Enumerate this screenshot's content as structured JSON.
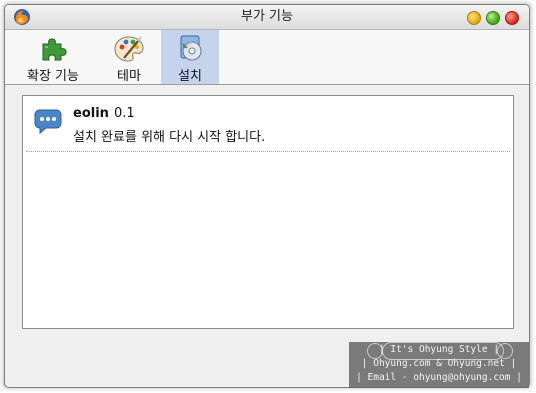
{
  "window": {
    "title": "부가 기능"
  },
  "titlebar_icons": {
    "app": "firefox-icon",
    "minimize": "minimize-icon",
    "maximize": "maximize-icon",
    "close": "close-icon"
  },
  "toolbar": {
    "tabs": [
      {
        "label": "확장 기능",
        "icon": "puzzle-piece-icon",
        "selected": false
      },
      {
        "label": "테마",
        "icon": "palette-icon",
        "selected": false
      },
      {
        "label": "설치",
        "icon": "install-disc-icon",
        "selected": true
      }
    ]
  },
  "install_list": {
    "items": [
      {
        "name": "eolin",
        "version": "0.1",
        "message": "설치 완료를 위해 다시 시작 합니다.",
        "icon": "chat-bubble-icon"
      }
    ]
  },
  "watermark": {
    "line1": "| It's Ohyung Style |",
    "line2": "| Ohyung.com & Ohyung.net |",
    "line3": "| Email - ohyung@ohyung.com |"
  },
  "colors": {
    "selected_tab": "#c4d4ec",
    "window_bg": "#efefef",
    "item_icon": "#4a86c6"
  }
}
